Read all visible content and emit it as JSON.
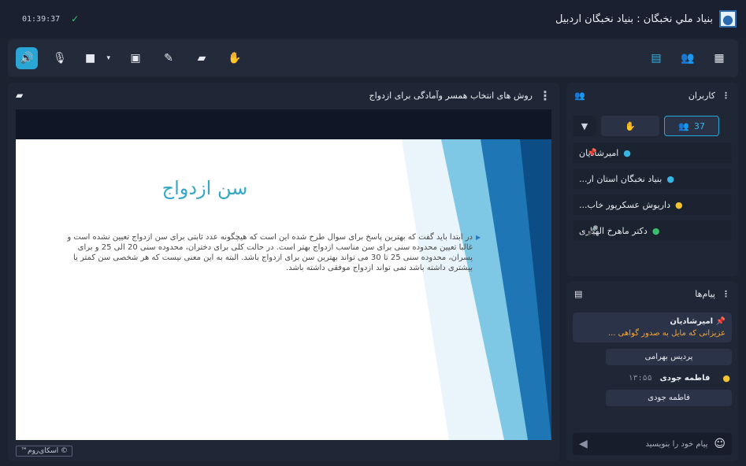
{
  "topbar": {
    "time": "01:39:37",
    "wifi_icon": "wifi-icon",
    "title": "بنیاد ملي نخبگان : بنیاد نخبگان اردبیل",
    "logo_icon": "app-logo-icon"
  },
  "toolbar": {
    "left": [
      {
        "name": "speaker-button",
        "icon": "speaker-icon",
        "glyph": "🔊",
        "active": true
      },
      {
        "name": "mic-button",
        "icon": "mic-off-icon",
        "glyph": "🎙"
      },
      {
        "name": "video-button",
        "icon": "video-off-icon",
        "glyph": "📷"
      },
      {
        "name": "screenshare-button",
        "icon": "screen-share-icon",
        "glyph": "▣"
      },
      {
        "name": "whiteboard-button",
        "icon": "pen-icon",
        "glyph": "✎"
      },
      {
        "name": "files-button",
        "icon": "folder-icon",
        "glyph": "▰"
      },
      {
        "name": "raise-hand-button",
        "icon": "hand-icon",
        "glyph": "✋"
      }
    ],
    "right": [
      {
        "name": "chat-toggle-button",
        "icon": "chat-icon",
        "glyph": "▤"
      },
      {
        "name": "users-toggle-button",
        "icon": "users-icon",
        "glyph": "👥"
      },
      {
        "name": "apps-button",
        "icon": "grid-icon",
        "glyph": "▦"
      }
    ]
  },
  "stage": {
    "title": "روش های انتخاب همسر وآمادگی برای ازدواج",
    "slide_title": "سن ازدواج",
    "slide_body": "در ابتدا باید گفت که بهترین پاسخ برای سوال طرح شده این است که هیچگونه عدد ثابتی برای سن ازدواج تعیین نشده است و غالبا تعیین محدوده سنی برای سن مناسب ازدواج بهتر است. در حالت کلی برای دختران، محدوده سنی 20 الی 25 و برای پسران، محدوده سنی 25 تا 30 می تواند بهترین سن برای ازدواج باشد. البته به این معنی نیست که هر شخصی سن کمتر یا بیشتری داشته باشد نمی تواند ازدواج موفقی داشته باشد.",
    "footer": "™اسکای‌روم ©"
  },
  "users": {
    "title": "کاربران",
    "count": "37",
    "list": [
      {
        "name": "امیرشادیان",
        "color": "blue",
        "marker": "pin"
      },
      {
        "name": "بنیاد نخبگان استان ار...",
        "color": "blue",
        "marker": ""
      },
      {
        "name": "داریوش عسکرپور خاب...",
        "color": "yellow",
        "marker": ""
      },
      {
        "name": "دکتر ماهرخ الهیاری",
        "color": "green",
        "marker": "mic"
      }
    ]
  },
  "messages": {
    "title": "پیام‌ها",
    "pinned_sender": "امیرشادیان",
    "pinned_text": "عزیزانی که مایل به صدور گواهی ...",
    "bubble1": "پردیس بهرامی",
    "meta_time": "۱۳:۵۵",
    "meta_name": "فاطمه جودی",
    "bubble2": "فاطمه جودی",
    "composer_placeholder": "پیام خود را بنویسید"
  }
}
